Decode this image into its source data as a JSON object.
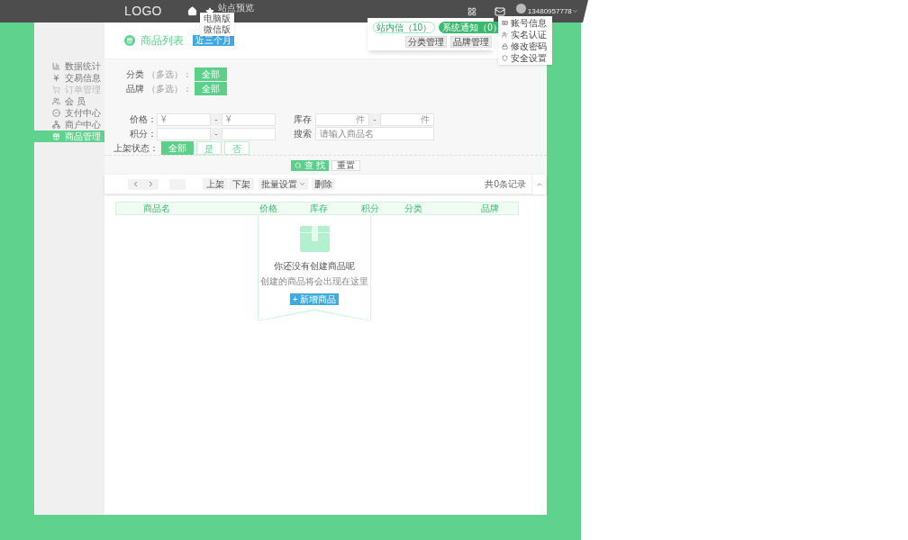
{
  "header": {
    "logo": "LOGO",
    "site_preview": {
      "label": "站点预览",
      "options": [
        "电脑版",
        "微信版"
      ]
    },
    "user": {
      "phone": "13480957778"
    }
  },
  "message_popup": {
    "tabs": [
      {
        "label": "站内信（10）",
        "selected": false
      },
      {
        "label": "系统通知（0）",
        "selected": true
      }
    ],
    "buttons": [
      "分类管理",
      "品牌管理"
    ]
  },
  "user_menu": [
    {
      "label": "账号信息",
      "kind": "account"
    },
    {
      "label": "实名认证",
      "kind": "verify"
    },
    {
      "label": "修改密码",
      "kind": "password"
    },
    {
      "label": "安全设置",
      "kind": "security"
    }
  ],
  "sidebar": [
    {
      "label": "数据统计",
      "kind": "stats",
      "selected": false,
      "disabled": false
    },
    {
      "label": "交易信息",
      "kind": "trade",
      "selected": false,
      "disabled": false
    },
    {
      "label": "订单管理",
      "kind": "orders",
      "selected": false,
      "disabled": true
    },
    {
      "label": "会 员",
      "kind": "members",
      "selected": false,
      "disabled": false
    },
    {
      "label": "支付中心",
      "kind": "payment",
      "selected": false,
      "disabled": false
    },
    {
      "label": "商户中心",
      "kind": "merchant",
      "selected": false,
      "disabled": false
    },
    {
      "label": "商品管理",
      "kind": "goods",
      "selected": true,
      "disabled": false
    }
  ],
  "page": {
    "title": "商品列表",
    "badge": "近三个月"
  },
  "filters": {
    "category": {
      "label": "分类",
      "hint": "（多选）：",
      "chips": [
        {
          "label": "全部",
          "selected": true
        }
      ]
    },
    "brand": {
      "label": "品牌",
      "hint": "（多选）：",
      "chips": [
        {
          "label": "全部",
          "selected": true
        }
      ]
    },
    "price": {
      "label": "价格：",
      "min_placeholder": "¥",
      "max_placeholder": "¥",
      "separator": "-"
    },
    "stock": {
      "label": "库存",
      "min_unit": "件",
      "max_unit": "件",
      "separator": "-"
    },
    "points": {
      "label": "积分：",
      "separator": "-"
    },
    "search": {
      "label": "搜索",
      "placeholder": "请输入商品名"
    },
    "status": {
      "label": "上架状态：",
      "options": [
        {
          "label": "全部",
          "selected": true
        },
        {
          "label": "是",
          "selected": false
        },
        {
          "label": "否",
          "selected": false
        }
      ]
    }
  },
  "actions": {
    "find": "查 找",
    "reset": "重置"
  },
  "toolbar": {
    "shelf_buttons": [
      "上架",
      "下架"
    ],
    "batch": "批量设置",
    "delete": "删除",
    "count": "共0条记录"
  },
  "table": {
    "columns": [
      "商品名",
      "价格",
      "库存",
      "积分",
      "分类",
      "品牌"
    ]
  },
  "empty": {
    "title": "你还没有创建商品呢",
    "subtitle": "创建的商品将会出现在这里",
    "button": "+ 新增商品"
  }
}
